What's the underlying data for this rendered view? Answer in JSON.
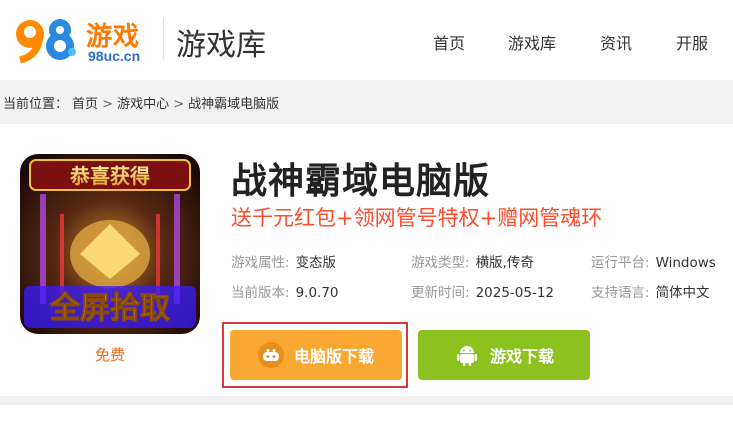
{
  "header": {
    "logo_number": "98",
    "logo_cn": "游戏",
    "logo_url": "98uc.cn",
    "site_title": "游戏库",
    "nav": [
      "首页",
      "游戏库",
      "资讯",
      "开服"
    ]
  },
  "breadcrumb": {
    "prefix": "当前位置：",
    "items": [
      "首页",
      "游戏中心",
      "战神霸域电脑版"
    ],
    "separator": ">"
  },
  "game": {
    "icon_text_top": "恭喜获得",
    "icon_text_bottom": "全屏拾取",
    "price_label": "免费",
    "title": "战神霸域电脑版",
    "slogan": "送千元红包+领网管号特权+赠网管魂环",
    "info": [
      {
        "key": "游戏属性:",
        "value": "变态版"
      },
      {
        "key": "游戏类型:",
        "value": "横版,传奇"
      },
      {
        "key": "运行平台:",
        "value": "Windows"
      },
      {
        "key": "当前版本:",
        "value": "9.0.70"
      },
      {
        "key": "更新时间:",
        "value": "2025-05-12"
      },
      {
        "key": "支持语言:",
        "value": "简体中文"
      }
    ]
  },
  "buttons": {
    "pc_download": "电脑版下载",
    "game_download": "游戏下载"
  },
  "icons": {
    "pc_button_icon": "gamepad-icon",
    "game_button_icon": "android-icon"
  },
  "colors": {
    "brand_orange": "#ff7a00",
    "brand_blue": "#2b6fcf",
    "slogan_red": "#ff4d2d",
    "pc_button": "#f9a833",
    "game_button": "#8cc11f",
    "highlight_box": "#d9363e"
  }
}
